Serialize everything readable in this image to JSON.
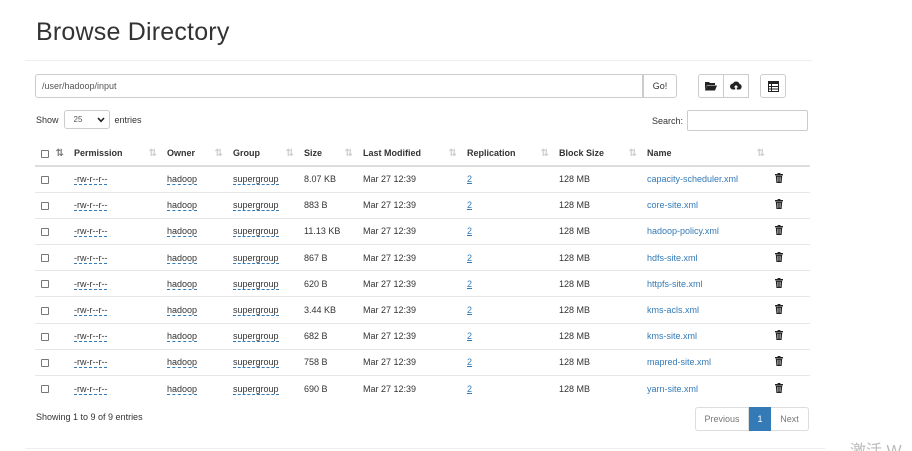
{
  "page_title": "Browse Directory",
  "path": {
    "value": "/user/hadoop/input",
    "go_label": "Go!"
  },
  "toolbar_icons": [
    "folder-open-icon",
    "upload-icon",
    "table-icon"
  ],
  "length": {
    "show_label": "Show",
    "value": "25",
    "entries_label": "entries"
  },
  "search": {
    "label": "Search:",
    "value": ""
  },
  "table": {
    "headers": [
      "Permission",
      "Owner",
      "Group",
      "Size",
      "Last Modified",
      "Replication",
      "Block Size",
      "Name"
    ],
    "rows": [
      {
        "permission": "-rw-r--r--",
        "owner": "hadoop",
        "group": "supergroup",
        "size": "8.07 KB",
        "modified": "Mar 27 12:39",
        "replication": "2",
        "block_size": "128 MB",
        "name": "capacity-scheduler.xml"
      },
      {
        "permission": "-rw-r--r--",
        "owner": "hadoop",
        "group": "supergroup",
        "size": "883 B",
        "modified": "Mar 27 12:39",
        "replication": "2",
        "block_size": "128 MB",
        "name": "core-site.xml"
      },
      {
        "permission": "-rw-r--r--",
        "owner": "hadoop",
        "group": "supergroup",
        "size": "11.13 KB",
        "modified": "Mar 27 12:39",
        "replication": "2",
        "block_size": "128 MB",
        "name": "hadoop-policy.xml"
      },
      {
        "permission": "-rw-r--r--",
        "owner": "hadoop",
        "group": "supergroup",
        "size": "867 B",
        "modified": "Mar 27 12:39",
        "replication": "2",
        "block_size": "128 MB",
        "name": "hdfs-site.xml"
      },
      {
        "permission": "-rw-r--r--",
        "owner": "hadoop",
        "group": "supergroup",
        "size": "620 B",
        "modified": "Mar 27 12:39",
        "replication": "2",
        "block_size": "128 MB",
        "name": "httpfs-site.xml"
      },
      {
        "permission": "-rw-r--r--",
        "owner": "hadoop",
        "group": "supergroup",
        "size": "3.44 KB",
        "modified": "Mar 27 12:39",
        "replication": "2",
        "block_size": "128 MB",
        "name": "kms-acls.xml"
      },
      {
        "permission": "-rw-r--r--",
        "owner": "hadoop",
        "group": "supergroup",
        "size": "682 B",
        "modified": "Mar 27 12:39",
        "replication": "2",
        "block_size": "128 MB",
        "name": "kms-site.xml"
      },
      {
        "permission": "-rw-r--r--",
        "owner": "hadoop",
        "group": "supergroup",
        "size": "758 B",
        "modified": "Mar 27 12:39",
        "replication": "2",
        "block_size": "128 MB",
        "name": "mapred-site.xml"
      },
      {
        "permission": "-rw-r--r--",
        "owner": "hadoop",
        "group": "supergroup",
        "size": "690 B",
        "modified": "Mar 27 12:39",
        "replication": "2",
        "block_size": "128 MB",
        "name": "yarn-site.xml"
      }
    ]
  },
  "info": "Showing 1 to 9 of 9 entries",
  "pagination": {
    "previous": "Previous",
    "current": "1",
    "next": "Next"
  },
  "watermark": "激活 W",
  "colors": {
    "link": "#337ab7",
    "active_page": "#337ab7",
    "border": "#dddddd"
  }
}
